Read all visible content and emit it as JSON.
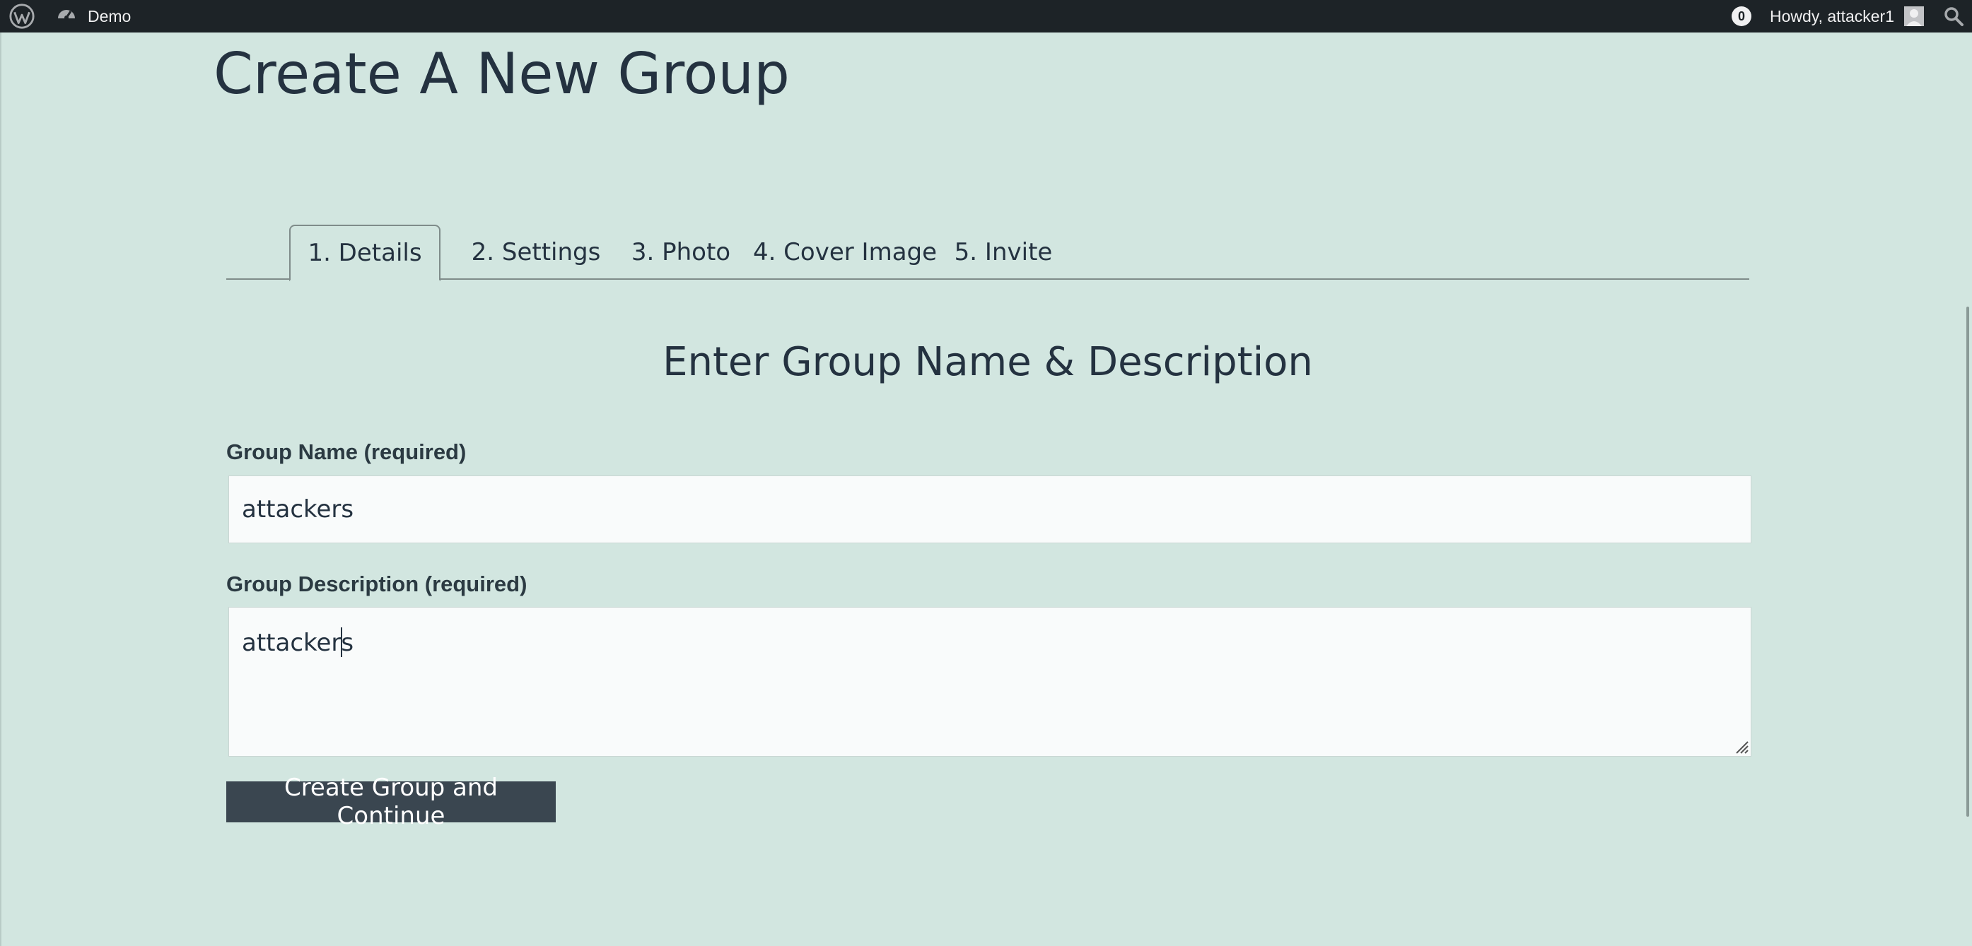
{
  "adminbar": {
    "site_name": "Demo",
    "notification_count": "0",
    "greeting": "Howdy, attacker1"
  },
  "page": {
    "title": "Create A New Group"
  },
  "tabs": [
    {
      "label": "1. Details",
      "active": true
    },
    {
      "label": "2. Settings",
      "active": false
    },
    {
      "label": "3. Photo",
      "active": false
    },
    {
      "label": "4. Cover Image",
      "active": false
    },
    {
      "label": "5. Invite",
      "active": false
    }
  ],
  "form": {
    "heading": "Enter Group Name & Description",
    "name_label": "Group Name (required)",
    "name_value": "attackers",
    "description_label": "Group Description (required)",
    "description_value": "attackers",
    "submit_label": "Create Group and Continue"
  },
  "colors": {
    "page_background": "#d2e6e0",
    "adminbar_background": "#1d2327",
    "button_background": "#3a4650",
    "text": "#243240"
  },
  "icons": {
    "wordpress": "wordpress-logo-icon",
    "dashboard": "dashboard-icon",
    "avatar": "user-avatar-icon",
    "search": "search-icon"
  }
}
